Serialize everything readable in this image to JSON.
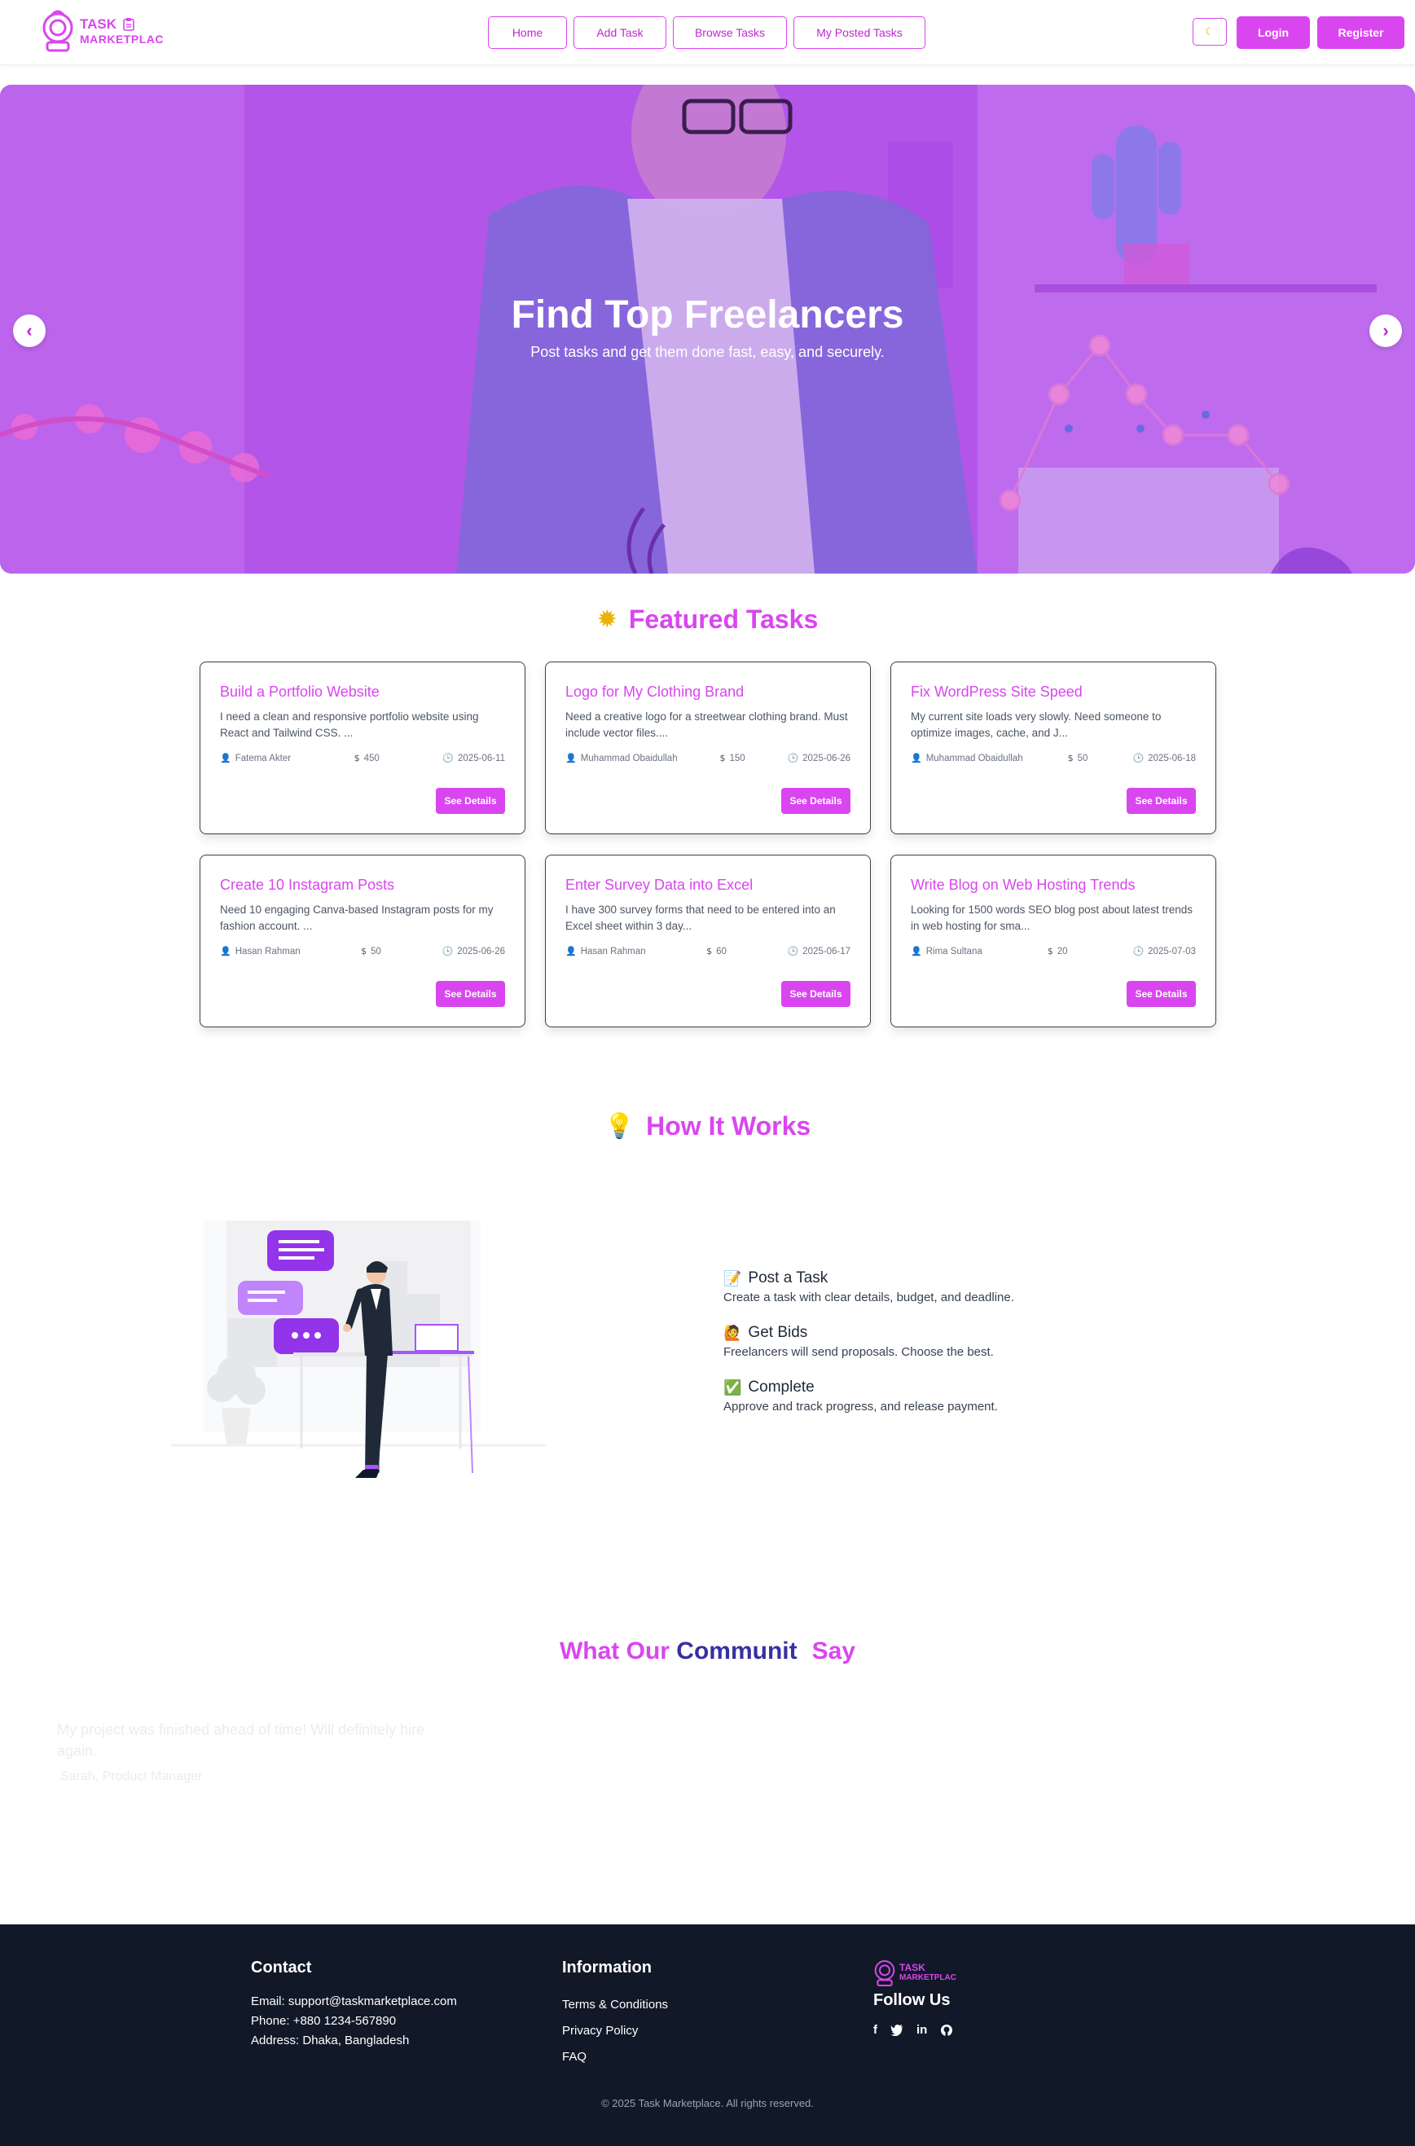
{
  "brand": {
    "line1": "TASK",
    "line2": "MARKETPLAC",
    "accent": "#d946ef"
  },
  "nav": {
    "links": [
      {
        "label": "Home"
      },
      {
        "label": "Add Task"
      },
      {
        "label": "Browse Tasks"
      },
      {
        "label": "My Posted Tasks"
      }
    ],
    "theme_icon": "moon-icon",
    "login": "Login",
    "register": "Register"
  },
  "hero": {
    "title": "Find Top Freelancers",
    "subtitle": "Post tasks and get them done fast, easy, and securely.",
    "prev": "‹",
    "next": "›"
  },
  "featured": {
    "title": "Featured Tasks",
    "tasks": [
      {
        "title": "Build a Portfolio Website",
        "desc": "I need a clean and responsive portfolio website using React and Tailwind CSS. ...",
        "author": "Fatema Akter",
        "budget": "450",
        "date": "2025-06-11",
        "button": "See Details"
      },
      {
        "title": "Logo for My Clothing Brand",
        "desc": "Need a creative logo for a streetwear clothing brand. Must include vector files....",
        "author": "Muhammad Obaidullah",
        "budget": "150",
        "date": "2025-06-26",
        "button": "See Details"
      },
      {
        "title": "Fix WordPress Site Speed",
        "desc": "My current site loads very slowly. Need someone to optimize images, cache, and J...",
        "author": "Muhammad Obaidullah",
        "budget": "50",
        "date": "2025-06-18",
        "button": "See Details"
      },
      {
        "title": "Create 10 Instagram Posts",
        "desc": "Need 10 engaging Canva-based Instagram posts for my fashion account. ...",
        "author": "Hasan Rahman",
        "budget": "50",
        "date": "2025-06-26",
        "button": "See Details"
      },
      {
        "title": "Enter Survey Data into Excel",
        "desc": "I have 300 survey forms that need to be entered into an Excel sheet within 3 day...",
        "author": "Hasan Rahman",
        "budget": "60",
        "date": "2025-06-17",
        "button": "See Details"
      },
      {
        "title": "Write Blog on Web Hosting Trends",
        "desc": "Looking for 1500 words SEO blog post about latest trends in web hosting for sma...",
        "author": "Rima Sultana",
        "budget": "20",
        "date": "2025-07-03",
        "button": "See Details"
      }
    ]
  },
  "how": {
    "title": "How It Works",
    "steps": [
      {
        "emoji": "📝",
        "title": "Post a Task",
        "desc": "Create a task with clear details, budget, and deadline."
      },
      {
        "emoji": "🙋",
        "title": "Get Bids",
        "desc": "Freelancers will send proposals. Choose the best."
      },
      {
        "emoji": "✅",
        "title": "Complete",
        "desc": "Approve and track progress, and release payment."
      }
    ]
  },
  "community": {
    "part1": "What Our ",
    "part2": "Communit",
    "part3": "Say",
    "quote": "My project was finished ahead of time! Will definitely hire again.",
    "name": "Sarah, Product Manager"
  },
  "footer": {
    "contact_title": "Contact",
    "email": "Email: support@taskmarketplace.com",
    "phone": "Phone: +880 1234-567890",
    "address": "Address: Dhaka, Bangladesh",
    "info_title": "Information",
    "links": [
      "Terms & Conditions",
      "Privacy Policy",
      "FAQ"
    ],
    "follow_title": "Follow Us",
    "social": [
      "facebook-icon",
      "twitter-icon",
      "linkedin-icon",
      "github-icon"
    ],
    "copyright": "© 2025 Task Marketplace. All rights reserved."
  }
}
